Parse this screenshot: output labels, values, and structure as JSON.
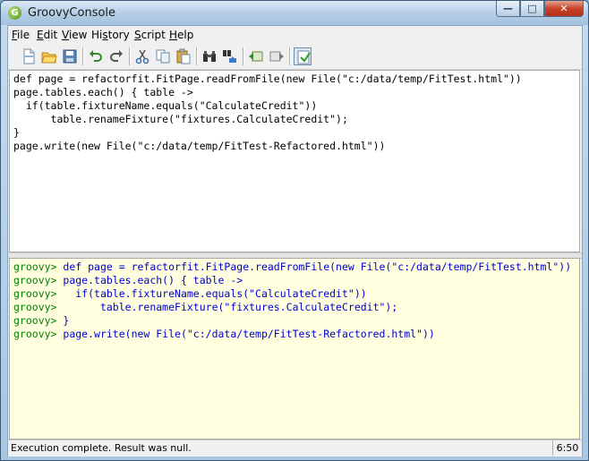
{
  "window": {
    "title": "GroovyConsole",
    "app_icon_letter": "G"
  },
  "window_controls": {
    "minimize": "—",
    "maximize": "□",
    "close": "✕"
  },
  "menu": [
    {
      "label": "File",
      "key": "F",
      "rest": "ile"
    },
    {
      "label": "Edit",
      "key": "E",
      "rest": "dit"
    },
    {
      "label": "View",
      "key": "V",
      "rest": "iew"
    },
    {
      "label": "History",
      "pre": "Hi",
      "key": "s",
      "rest": "tory"
    },
    {
      "label": "Script",
      "key": "S",
      "rest": "cript"
    },
    {
      "label": "Help",
      "key": "H",
      "rest": "elp"
    }
  ],
  "toolbar": {
    "icons": [
      "new-file-icon",
      "open-folder-icon",
      "save-icon",
      "undo-icon",
      "redo-icon",
      "cut-icon",
      "copy-icon",
      "paste-icon",
      "find-icon",
      "replace-icon",
      "history-prev-icon",
      "history-next-icon",
      "run-script-icon"
    ]
  },
  "editor": {
    "lines": [
      "def page = refactorfit.FitPage.readFromFile(new File(\"c:/data/temp/FitTest.html\"))",
      "page.tables.each() { table ->",
      "  if(table.fixtureName.equals(\"CalculateCredit\"))",
      "      table.renameFixture(\"fixtures.CalculateCredit\");",
      "}",
      "page.write(new File(\"c:/data/temp/FitTest-Refactored.html\"))"
    ]
  },
  "output": {
    "prompt": "groovy>",
    "lines": [
      "def page = refactorfit.FitPage.readFromFile(new File(\"c:/data/temp/FitTest.html\"))",
      "page.tables.each() { table ->",
      "  if(table.fixtureName.equals(\"CalculateCredit\"))",
      "      table.renameFixture(\"fixtures.CalculateCredit\");",
      "}",
      "page.write(new File(\"c:/data/temp/FitTest-Refactored.html\"))"
    ]
  },
  "status": {
    "message": "Execution complete. Result was null.",
    "position": "6:50"
  }
}
